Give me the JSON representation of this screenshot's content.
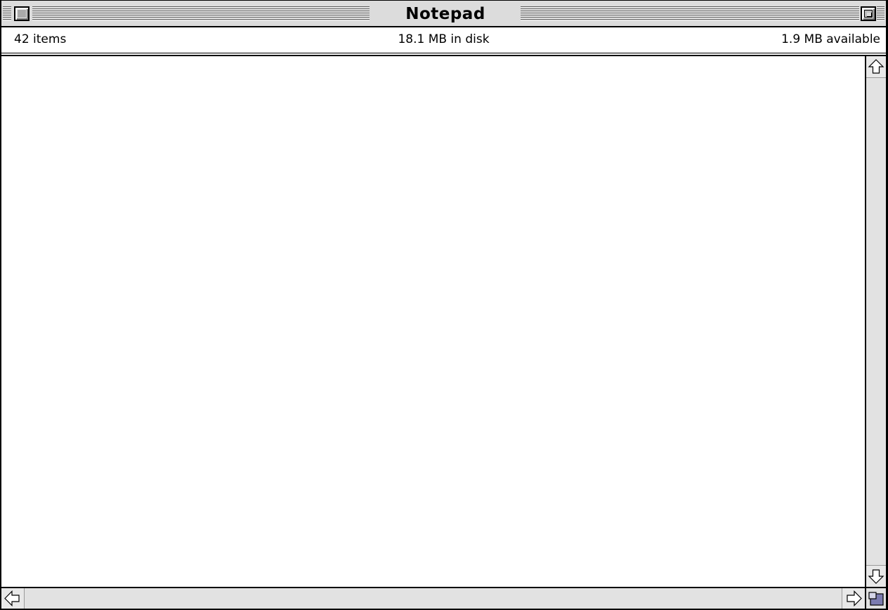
{
  "window": {
    "title": "Notepad"
  },
  "info_bar": {
    "item_count": "42 items",
    "disk_usage": "18.1 MB in disk",
    "available": "1.9 MB available"
  },
  "icons": {
    "close": "close-box-icon",
    "zoom": "zoom-box-icon",
    "scroll_up": "arrow-up-icon",
    "scroll_down": "arrow-down-icon",
    "scroll_left": "arrow-left-icon",
    "scroll_right": "arrow-right-icon",
    "grow": "grow-box-icon"
  },
  "colors": {
    "window_frame": "#000000",
    "title_bar": "#dcdcdc",
    "scrollbar_track": "#e2e2e2",
    "accent": "#3c3c8c"
  }
}
